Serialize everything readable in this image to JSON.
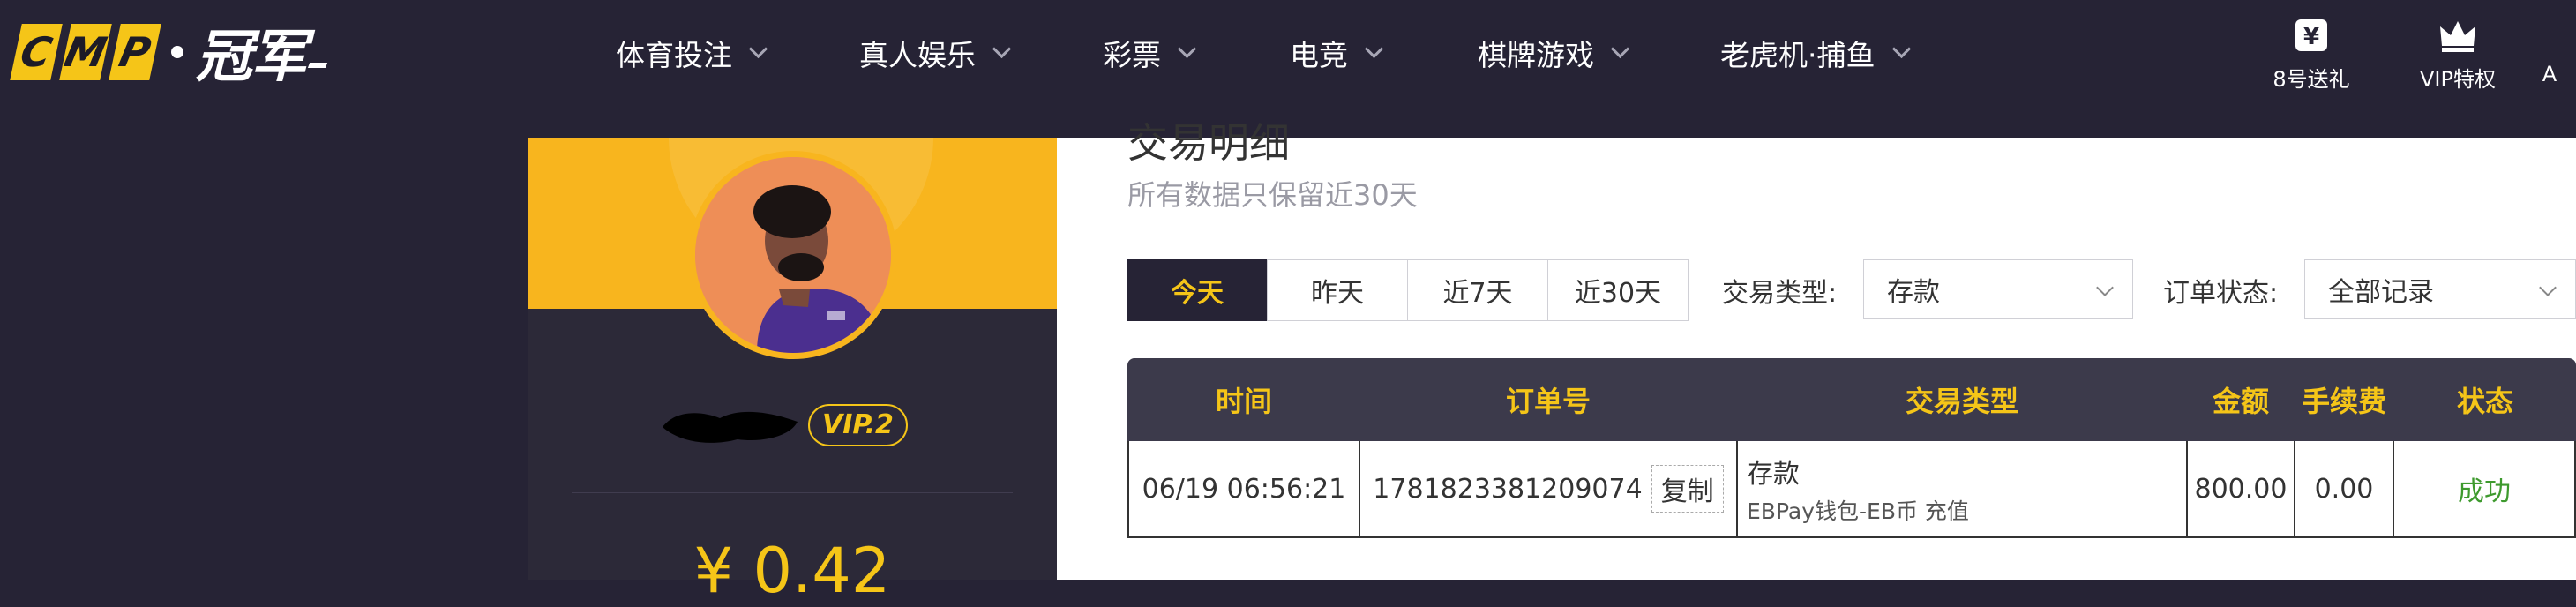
{
  "logo": {
    "letters": [
      "C",
      "M",
      "P"
    ],
    "word": "冠军"
  },
  "nav": {
    "items": [
      {
        "label": "体育投注"
      },
      {
        "label": "真人娱乐"
      },
      {
        "label": "彩票"
      },
      {
        "label": "电竞"
      },
      {
        "label": "棋牌游戏"
      },
      {
        "label": "老虎机·捕鱼"
      }
    ],
    "links": [
      {
        "label": "8号送礼",
        "icon": "yen-gift-icon"
      },
      {
        "label": "VIP特权",
        "icon": "crown-icon"
      },
      {
        "label": "A",
        "icon": "app-icon"
      }
    ]
  },
  "profile": {
    "vip_label": "VIP.2",
    "balance": "¥ 0.42"
  },
  "records": {
    "clipped_title": "交易明细",
    "subtitle": "所有数据只保留近30天",
    "tabs": [
      {
        "label": "今天",
        "active": true
      },
      {
        "label": "昨天",
        "active": false
      },
      {
        "label": "近7天",
        "active": false
      },
      {
        "label": "近30天",
        "active": false
      }
    ],
    "filters": {
      "type_label": "交易类型:",
      "type_value": "存款",
      "status_label": "订单状态:",
      "status_value": "全部记录"
    },
    "table": {
      "headers": [
        "时间",
        "订单号",
        "交易类型",
        "金额",
        "手续费",
        "状态"
      ],
      "rows": [
        {
          "time": "06/19 06:56:21",
          "order_no": "1781823381209074",
          "copy_label": "复制",
          "type": "存款",
          "type_detail": "EBPay钱包-EB币 充值",
          "amount": "800.00",
          "fee": "0.00",
          "status": "成功"
        }
      ]
    }
  },
  "colors": {
    "accent": "#f5c518",
    "nav_bg": "#262335",
    "success": "#3e9a2e"
  }
}
